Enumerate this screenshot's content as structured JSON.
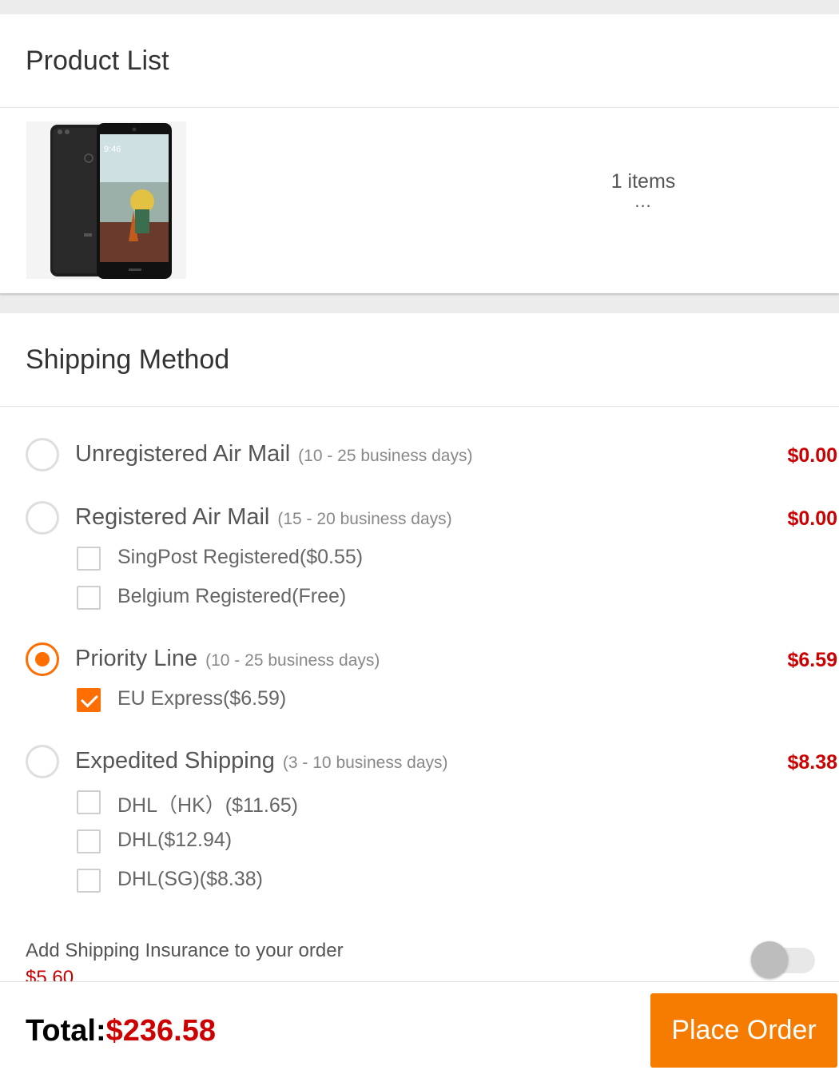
{
  "product_list": {
    "title": "Product List",
    "items_count": "1 items",
    "items_more": "..."
  },
  "shipping": {
    "title": "Shipping Method",
    "methods": [
      {
        "name": "Unregistered Air Mail",
        "days": "(10 - 25 business days)",
        "price": "$0.00",
        "selected": false,
        "options": []
      },
      {
        "name": "Registered Air Mail",
        "days": "(15 - 20 business days)",
        "price": "$0.00",
        "selected": false,
        "options": [
          {
            "label": "SingPost Registered($0.55)",
            "checked": false
          },
          {
            "label": "Belgium Registered(Free)",
            "checked": false
          }
        ]
      },
      {
        "name": "Priority Line",
        "days": "(10 - 25 business days)",
        "price": "$6.59",
        "selected": true,
        "options": [
          {
            "label": "EU Express($6.59)",
            "checked": true
          }
        ]
      },
      {
        "name": "Expedited Shipping",
        "days": "(3 - 10 business days)",
        "price": "$8.38",
        "selected": false,
        "options": [
          {
            "label": "DHL（HK）($11.65)",
            "checked": false
          },
          {
            "label": "DHL($12.94)",
            "checked": false
          },
          {
            "label": "DHL(SG)($8.38)",
            "checked": false
          }
        ]
      }
    ],
    "insurance_label": "Add Shipping Insurance to your order",
    "insurance_price": "$5.60",
    "insurance_enabled": false
  },
  "footer": {
    "total_label": "Total:",
    "total_value": "$236.58",
    "place_order_label": "Place Order"
  },
  "colors": {
    "accent": "#ff6e00",
    "price": "#cc0000",
    "button": "#f57c00"
  }
}
